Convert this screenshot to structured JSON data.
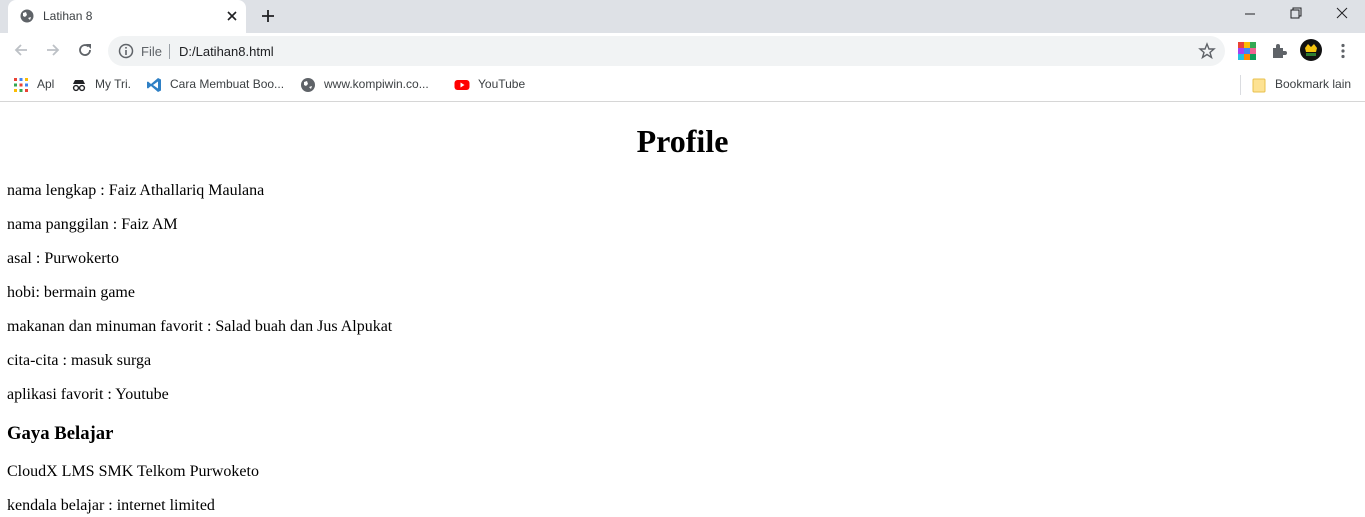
{
  "browser": {
    "tab": {
      "title": "Latihan 8"
    },
    "omnibox": {
      "scheme": "File",
      "url": "D:/Latihan8.html"
    },
    "bookmarks": [
      {
        "label": "Apl",
        "icon": "apps-grid-icon"
      },
      {
        "label": "My Tri.",
        "icon": "incognito-icon"
      },
      {
        "label": "Cara Membuat Boo...",
        "icon": "vscode-icon"
      },
      {
        "label": "www.kompiwin.co...",
        "icon": "globe-icon"
      },
      {
        "label": "YouTube",
        "icon": "youtube-icon"
      }
    ],
    "other_bookmarks": "Bookmark lain"
  },
  "page": {
    "title": "Profile",
    "fields": [
      "nama lengkap : Faiz Athallariq Maulana",
      "nama panggilan : Faiz AM",
      "asal : Purwokerto",
      "hobi: bermain game",
      "makanan dan minuman favorit : Salad buah dan Jus Alpukat",
      "cita-cita : masuk surga",
      "aplikasi favorit : Youtube"
    ],
    "section_heading": "Gaya Belajar",
    "section_lines": [
      "CloudX LMS SMK Telkom Purwoketo",
      "kendala belajar : internet limited"
    ]
  },
  "colors": {
    "frame": "#dee1e6",
    "omnibox": "#f1f3f4",
    "youtube_red": "#ff0000",
    "icon_gray": "#5f6368"
  }
}
